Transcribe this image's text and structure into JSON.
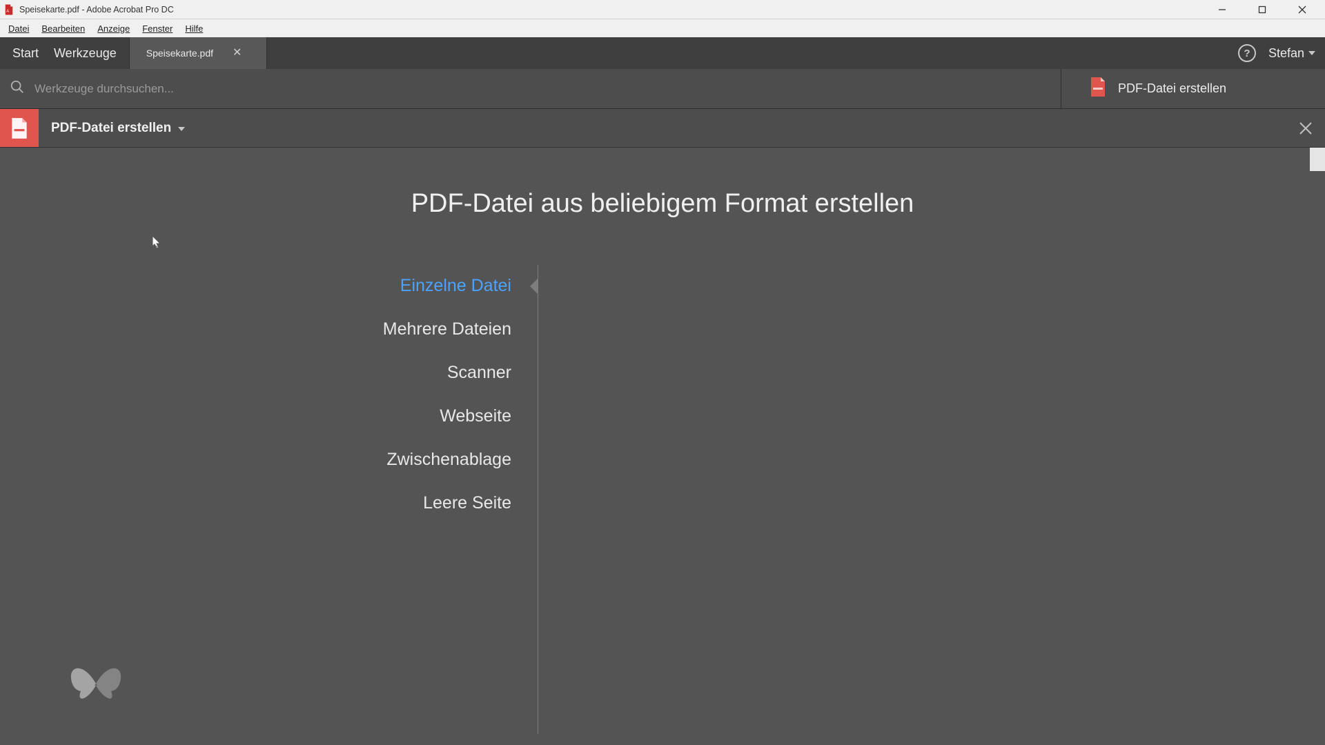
{
  "window": {
    "title": "Speisekarte.pdf - Adobe Acrobat Pro DC"
  },
  "menubar": {
    "items": [
      "Datei",
      "Bearbeiten",
      "Anzeige",
      "Fenster",
      "Hilfe"
    ]
  },
  "tabstrip": {
    "start": "Start",
    "tools": "Werkzeuge",
    "doc_tab": "Speisekarte.pdf",
    "user_name": "Stefan"
  },
  "search": {
    "placeholder": "Werkzeuge durchsuchen..."
  },
  "side_action": {
    "label": "PDF-Datei erstellen"
  },
  "toolheader": {
    "label": "PDF-Datei erstellen"
  },
  "page": {
    "title": "PDF-Datei aus beliebigem Format erstellen",
    "options": [
      {
        "label": "Einzelne Datei",
        "selected": true
      },
      {
        "label": "Mehrere Dateien",
        "selected": false
      },
      {
        "label": "Scanner",
        "selected": false
      },
      {
        "label": "Webseite",
        "selected": false
      },
      {
        "label": "Zwischenablage",
        "selected": false
      },
      {
        "label": "Leere Seite",
        "selected": false
      }
    ]
  },
  "colors": {
    "accent_red": "#e0564f",
    "link_blue": "#4aa3ff"
  }
}
